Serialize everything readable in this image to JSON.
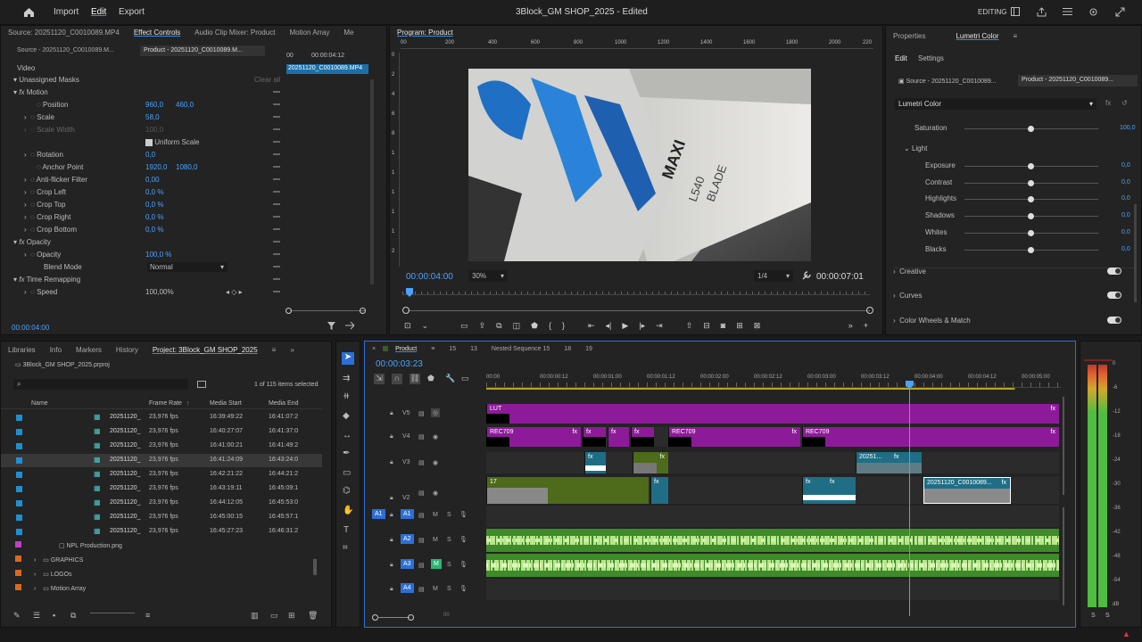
{
  "topbar": {
    "import": "Import",
    "edit": "Edit",
    "export": "Export",
    "title": "3Block_GM SHOP_2025 - Edited",
    "workspace": "EDITING"
  },
  "source_tabs": {
    "source": "Source: 20251120_C0010089.MP4",
    "effect": "Effect Controls",
    "mixer": "Audio Clip Mixer: Product",
    "motion": "Motion Array",
    "more": "Me"
  },
  "effect_controls": {
    "src_tab": "Source - 20251120_C0010089.M...",
    "prod_tab": "Product - 20251120_C0010089.M...",
    "clip_time": "00:00:04:12",
    "clip_label": "20251120_C0010089.MP4",
    "header_t": "00",
    "video": "Video",
    "masks": "Unassigned Masks",
    "clear_all": "Clear all",
    "motion": "Motion",
    "position": "Position",
    "pos_x": "960,0",
    "pos_y": "460,0",
    "scale": "Scale",
    "scale_v": "58,0",
    "scale_width": "Scale Width",
    "scale_width_v": "100,0",
    "uniform": "Uniform Scale",
    "rotation": "Rotation",
    "rotation_v": "0,0",
    "anchor": "Anchor Point",
    "anc_x": "1920,0",
    "anc_y": "1080,0",
    "antiflicker": "Anti-flicker Filter",
    "antiflicker_v": "0,00",
    "crop_left": "Crop Left",
    "crop_left_v": "0,0 %",
    "crop_top": "Crop Top",
    "crop_top_v": "0,0 %",
    "crop_right": "Crop Right",
    "crop_right_v": "0,0 %",
    "crop_bottom": "Crop Bottom",
    "crop_bottom_v": "0,0 %",
    "opacity_grp": "Opacity",
    "opacity": "Opacity",
    "opacity_v": "100,0 %",
    "blend": "Blend Mode",
    "blend_v": "Normal",
    "remap": "Time Remapping",
    "speed": "Speed",
    "speed_v": "100,00%",
    "timecode": "00:00:04:00"
  },
  "program": {
    "tab": "Program: Product",
    "timecode": "00:00:04:00",
    "zoom": "30%",
    "quality": "1/4",
    "duration": "00:00:07:01",
    "ruler": [
      "00",
      "200",
      "400",
      "600",
      "800",
      "1000",
      "1200",
      "1400",
      "1600",
      "1800",
      "2000",
      "220"
    ],
    "vruler": [
      "0",
      "2",
      "4",
      "6",
      "8",
      "1",
      "1",
      "1",
      "1",
      "1",
      "2"
    ],
    "frame_text_1": "MAXI",
    "frame_text_2": "L540",
    "frame_text_3": "BLADE"
  },
  "lumetri": {
    "tab_properties": "Properties",
    "tab_lumetri": "Lumetri Color",
    "edit": "Edit",
    "settings": "Settings",
    "src_tab": "Source - 20251120_C0010089...",
    "prod_tab": "Product - 20251120_C0010089...",
    "effect": "Lumetri Color",
    "saturation": "Saturation",
    "saturation_v": "100,0",
    "light": "Light",
    "sliders": [
      {
        "name": "Exposure",
        "v": "0,0"
      },
      {
        "name": "Contrast",
        "v": "0,0"
      },
      {
        "name": "Highlights",
        "v": "0,0"
      },
      {
        "name": "Shadows",
        "v": "0,0"
      },
      {
        "name": "Whites",
        "v": "0,0"
      },
      {
        "name": "Blacks",
        "v": "0,0"
      }
    ],
    "creative": "Creative",
    "curves": "Curves",
    "wheels": "Color Wheels & Match"
  },
  "project": {
    "tabs": [
      "Libraries",
      "Info",
      "Markers",
      "History",
      "Project: 3Block_GM SHOP_2025"
    ],
    "file": "3Block_GM SHOP_2025.prproj",
    "count": "1 of 115 items selected",
    "cols": [
      "Name",
      "Frame Rate",
      "Media Start",
      "Media End"
    ],
    "rows": [
      {
        "name": "20251120_",
        "fps": "23,976 fps",
        "start": "16:39:49:22",
        "end": "16:41:07:2"
      },
      {
        "name": "20251120_",
        "fps": "23,976 fps",
        "start": "16:40:27:07",
        "end": "16:41:37:0"
      },
      {
        "name": "20251120_",
        "fps": "23,976 fps",
        "start": "16:41:00:21",
        "end": "16:41:49:2"
      },
      {
        "name": "20251120_",
        "fps": "23,976 fps",
        "start": "16:41:24:09",
        "end": "16:43:24:0"
      },
      {
        "name": "20251120_",
        "fps": "23,976 fps",
        "start": "16:42:21:22",
        "end": "16:44:21:2"
      },
      {
        "name": "20251120_",
        "fps": "23,976 fps",
        "start": "16:43:19:11",
        "end": "16:45:09:1"
      },
      {
        "name": "20251120_",
        "fps": "23,976 fps",
        "start": "16:44:12:05",
        "end": "16:45:53:0"
      },
      {
        "name": "20251120_",
        "fps": "23,976 fps",
        "start": "16:45:00:15",
        "end": "16:45:57:1"
      },
      {
        "name": "20251120_",
        "fps": "23,976 fps",
        "start": "16:45:27:23",
        "end": "16:46:31:2"
      }
    ],
    "png": "NPL Production.png",
    "folders": [
      "GRAPHICS",
      "LOGOs",
      "Motion Array"
    ]
  },
  "timeline": {
    "tabs": [
      "Product",
      "15",
      "13",
      "Nested Sequence 15",
      "18",
      "19"
    ],
    "timecode": "00:00:03:23",
    "ruler": [
      "00:00",
      "00:00:00:12",
      "00:00:01:00",
      "00:00:01:12",
      "00:00:02:00",
      "00:00:02:12",
      "00:00:03:00",
      "00:00:03:12",
      "00:00:04:00",
      "00:00:04:12",
      "00:00:05:00"
    ],
    "tracks_v": [
      "V5",
      "V4",
      "V3",
      "V2"
    ],
    "tracks_a": [
      "A1",
      "A2",
      "A3",
      "A4"
    ],
    "clips": {
      "lut": "LUT",
      "rec1": "REC709",
      "rec2": "REC709",
      "rec3": "REC709",
      "v3a": "20251...",
      "v2a": "17",
      "v2b": "20251120_C0010089..."
    },
    "audio_m": "M",
    "audio_s": "S",
    "fx": "fx",
    "bottom_tc": "00"
  },
  "meter": {
    "ticks": [
      "0",
      "-6",
      "-12",
      "-18",
      "-24",
      "-30",
      "-36",
      "-42",
      "-48",
      "-54",
      "dB"
    ],
    "ls": "S",
    "rs": "S"
  }
}
